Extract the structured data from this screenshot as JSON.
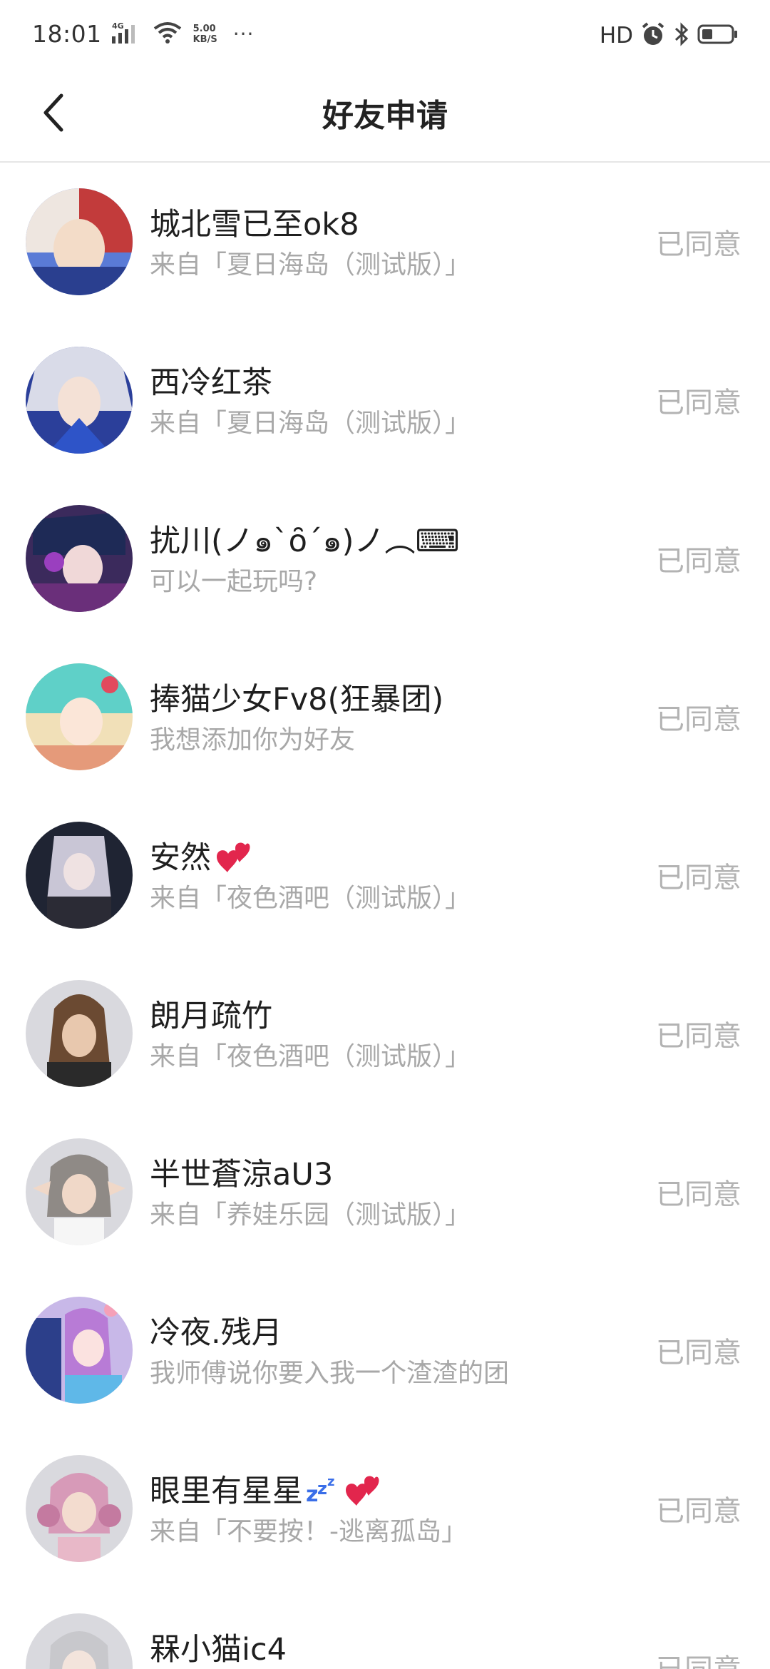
{
  "status_bar": {
    "time": "18:01",
    "network_label": "4G",
    "speed_value": "5.00",
    "speed_unit": "KB/S",
    "more": "···",
    "hd_label": "HD"
  },
  "header": {
    "title": "好友申请"
  },
  "requests": [
    {
      "name": "城北雪已至ok8",
      "subtitle": "来自「夏日海岛（测试版）」",
      "status": "已同意"
    },
    {
      "name": "西冷红茶",
      "subtitle": "来自「夏日海岛（测试版）」",
      "status": "已同意"
    },
    {
      "name": "扰川(ノ๑`ȏ´๑)ノ︵⌨",
      "subtitle": "可以一起玩吗?",
      "status": "已同意"
    },
    {
      "name": "捧猫少女Fv8(狂暴团)",
      "subtitle": "我想添加你为好友",
      "status": "已同意"
    },
    {
      "name": "安然",
      "subtitle": "来自「夜色酒吧（测试版）」",
      "status": "已同意"
    },
    {
      "name": "朗月疏竹",
      "subtitle": "来自「夜色酒吧（测试版）」",
      "status": "已同意"
    },
    {
      "name": "半世蒼涼aU3",
      "subtitle": "来自「养娃乐园（测试版）」",
      "status": "已同意"
    },
    {
      "name": "冷夜.残月",
      "subtitle": "我师傅说你要入我一个渣渣的团",
      "status": "已同意"
    },
    {
      "name": "眼里有星星",
      "subtitle": "来自「不要按！-逃离孤岛」",
      "status": "已同意"
    },
    {
      "name": "槑小猫ic4",
      "subtitle": "",
      "status": "已同意"
    }
  ],
  "colors": {
    "accent_text": "#222222",
    "muted_text": "#a8a8a8",
    "status_text": "#b3b3b3"
  }
}
